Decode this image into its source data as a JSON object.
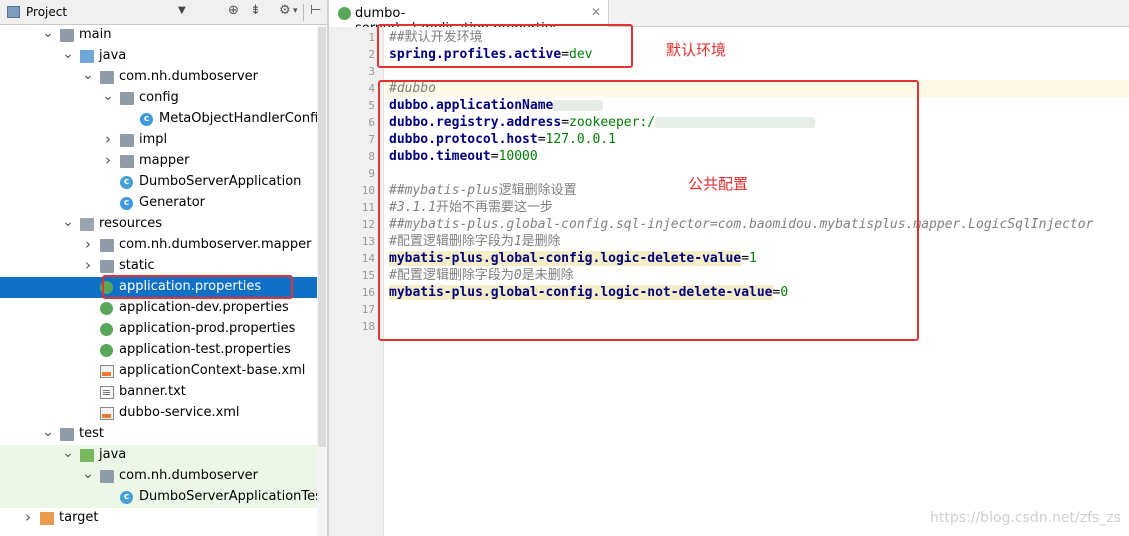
{
  "project_panel": {
    "title": "Project",
    "tree": [
      {
        "label": "main",
        "indent": 2,
        "arrow": "down",
        "icon": "folder"
      },
      {
        "label": "java",
        "indent": 3,
        "arrow": "down",
        "icon": "folder-blue"
      },
      {
        "label": "com.nh.dumboserver",
        "indent": 4,
        "arrow": "down",
        "icon": "package"
      },
      {
        "label": "config",
        "indent": 5,
        "arrow": "down",
        "icon": "package"
      },
      {
        "label": "MetaObjectHandlerConfig",
        "indent": 6,
        "arrow": "",
        "icon": "class"
      },
      {
        "label": "impl",
        "indent": 5,
        "arrow": "right",
        "icon": "package"
      },
      {
        "label": "mapper",
        "indent": 5,
        "arrow": "right",
        "icon": "package"
      },
      {
        "label": "DumboServerApplication",
        "indent": 5,
        "arrow": "",
        "icon": "class-run"
      },
      {
        "label": "Generator",
        "indent": 5,
        "arrow": "",
        "icon": "class"
      },
      {
        "label": "resources",
        "indent": 3,
        "arrow": "down",
        "icon": "folder-res"
      },
      {
        "label": "com.nh.dumboserver.mapper",
        "indent": 4,
        "arrow": "right",
        "icon": "package"
      },
      {
        "label": "static",
        "indent": 4,
        "arrow": "right",
        "icon": "package"
      },
      {
        "label": "application.properties",
        "indent": 4,
        "arrow": "",
        "icon": "spring",
        "selected": true
      },
      {
        "label": "application-dev.properties",
        "indent": 4,
        "arrow": "",
        "icon": "spring"
      },
      {
        "label": "application-prod.properties",
        "indent": 4,
        "arrow": "",
        "icon": "spring"
      },
      {
        "label": "application-test.properties",
        "indent": 4,
        "arrow": "",
        "icon": "spring"
      },
      {
        "label": "applicationContext-base.xml",
        "indent": 4,
        "arrow": "",
        "icon": "xml"
      },
      {
        "label": "banner.txt",
        "indent": 4,
        "arrow": "",
        "icon": "txt"
      },
      {
        "label": "dubbo-service.xml",
        "indent": 4,
        "arrow": "",
        "icon": "xml"
      },
      {
        "label": "test",
        "indent": 2,
        "arrow": "down",
        "icon": "folder"
      },
      {
        "label": "java",
        "indent": 3,
        "arrow": "down",
        "icon": "folder-green",
        "green": true
      },
      {
        "label": "com.nh.dumboserver",
        "indent": 4,
        "arrow": "down",
        "icon": "package",
        "green": true
      },
      {
        "label": "DumboServerApplicationTest",
        "indent": 5,
        "arrow": "",
        "icon": "class-run",
        "green": true
      },
      {
        "label": "target",
        "indent": 1,
        "arrow": "right",
        "icon": "folder-orange"
      }
    ]
  },
  "editor": {
    "tab_label": "dumbo-server\\...\\application.properties",
    "lines": [
      {
        "n": "1",
        "segs": [
          {
            "t": "##默认开发环境",
            "c": "cmz"
          }
        ]
      },
      {
        "n": "2",
        "segs": [
          {
            "t": "spring.profiles.active",
            "c": "key"
          },
          {
            "t": "=",
            "c": "eq"
          },
          {
            "t": "dev",
            "c": "val"
          }
        ]
      },
      {
        "n": "3",
        "segs": []
      },
      {
        "n": "4",
        "segs": [
          {
            "t": "#dubbo",
            "c": "cm"
          }
        ],
        "current": true
      },
      {
        "n": "5",
        "segs": [
          {
            "t": "dubbo.applicationName",
            "c": "key"
          },
          {
            "blur": 50
          }
        ]
      },
      {
        "n": "6",
        "segs": [
          {
            "t": "dubbo.registry.address",
            "c": "key"
          },
          {
            "t": "=",
            "c": "eq"
          },
          {
            "t": "zookeeper:/",
            "c": "val"
          },
          {
            "blur": 160
          }
        ]
      },
      {
        "n": "7",
        "segs": [
          {
            "t": "dubbo.protocol.host",
            "c": "key"
          },
          {
            "t": "=",
            "c": "eq"
          },
          {
            "t": "127.0.0.1",
            "c": "val"
          }
        ]
      },
      {
        "n": "8",
        "segs": [
          {
            "t": "dubbo.timeout",
            "c": "key"
          },
          {
            "t": "=",
            "c": "eq"
          },
          {
            "t": "10000",
            "c": "val"
          }
        ]
      },
      {
        "n": "9",
        "segs": []
      },
      {
        "n": "10",
        "segs": [
          {
            "t": "##",
            "c": "cmz"
          },
          {
            "t": "mybatis-plus",
            "c": "cm"
          },
          {
            "t": "逻辑删除设置",
            "c": "cmz"
          }
        ]
      },
      {
        "n": "11",
        "segs": [
          {
            "t": "#",
            "c": "cmz"
          },
          {
            "t": "3.1.1",
            "c": "cm"
          },
          {
            "t": "开始不再需要这一步",
            "c": "cmz"
          }
        ]
      },
      {
        "n": "12",
        "segs": [
          {
            "t": "##mybatis-plus.global-config.sql-injector=com.baomidou.mybatisplus.mapper.LogicSqlInjector",
            "c": "cm"
          }
        ]
      },
      {
        "n": "13",
        "segs": [
          {
            "t": "#配置逻辑删除字段为",
            "c": "cmz"
          },
          {
            "t": "1",
            "c": "cm"
          },
          {
            "t": "是删除",
            "c": "cmz"
          }
        ]
      },
      {
        "n": "14",
        "segs": [
          {
            "t": "mybatis-plus.global-config.logic-delete-value",
            "c": "key hl"
          },
          {
            "t": "=",
            "c": "eq"
          },
          {
            "t": "1",
            "c": "val"
          }
        ]
      },
      {
        "n": "15",
        "segs": [
          {
            "t": "#配置逻辑删除字段为",
            "c": "cmz"
          },
          {
            "t": "0",
            "c": "cm"
          },
          {
            "t": "是未删除",
            "c": "cmz"
          }
        ]
      },
      {
        "n": "16",
        "segs": [
          {
            "t": "mybatis-plus.global-config.logic-not-delete-value",
            "c": "key hl"
          },
          {
            "t": "=",
            "c": "eq"
          },
          {
            "t": "0",
            "c": "val"
          }
        ]
      },
      {
        "n": "17",
        "segs": []
      },
      {
        "n": "18",
        "segs": []
      }
    ]
  },
  "annotations": {
    "default_env": "默认环境",
    "public_config": "公共配置"
  },
  "watermark": "https://blog.csdn.net/zfs_zs",
  "colors": {
    "selection": "#0f70c6",
    "annotation_red": "#e23232",
    "key_blue": "#000080",
    "value_green": "#008000",
    "comment_gray": "#808080"
  }
}
